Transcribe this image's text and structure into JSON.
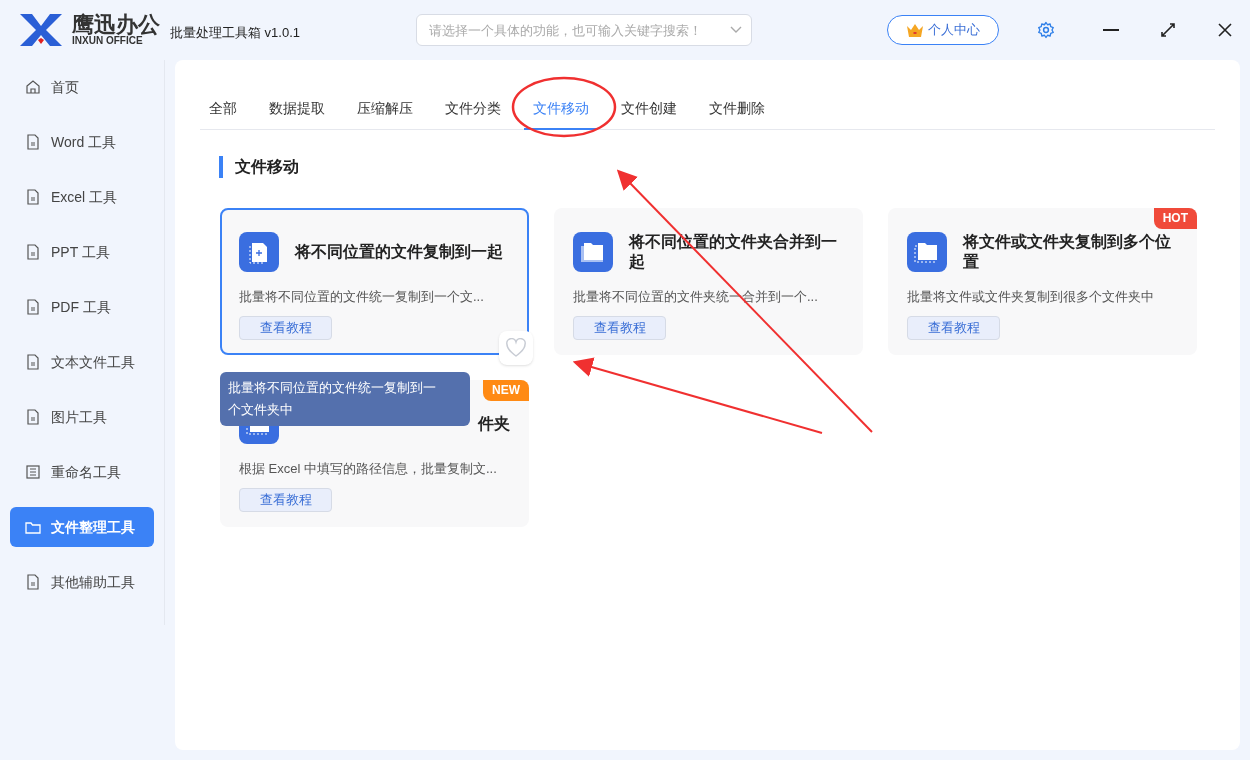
{
  "app": {
    "logo_cn": "鹰迅办公",
    "logo_en": "INXUN OFFICE",
    "title": "批量处理工具箱 v1.0.1"
  },
  "search": {
    "placeholder": "请选择一个具体的功能，也可输入关键字搜索！"
  },
  "user_button": "个人中心",
  "sidebar": {
    "items": [
      {
        "label": "首页",
        "kind": "home",
        "selected": false
      },
      {
        "label": "Word 工具",
        "kind": "doc",
        "selected": false
      },
      {
        "label": "Excel 工具",
        "kind": "doc",
        "selected": false
      },
      {
        "label": "PPT 工具",
        "kind": "doc",
        "selected": false
      },
      {
        "label": "PDF 工具",
        "kind": "doc",
        "selected": false
      },
      {
        "label": "文本文件工具",
        "kind": "doc",
        "selected": false
      },
      {
        "label": "图片工具",
        "kind": "doc",
        "selected": false
      },
      {
        "label": "重命名工具",
        "kind": "list",
        "selected": false
      },
      {
        "label": "文件整理工具",
        "kind": "folder",
        "selected": true
      },
      {
        "label": "其他辅助工具",
        "kind": "doc",
        "selected": false
      }
    ]
  },
  "tabs": [
    {
      "label": "全部",
      "selected": false
    },
    {
      "label": "数据提取",
      "selected": false
    },
    {
      "label": "压缩解压",
      "selected": false
    },
    {
      "label": "文件分类",
      "selected": false
    },
    {
      "label": "文件移动",
      "selected": true
    },
    {
      "label": "文件创建",
      "selected": false
    },
    {
      "label": "文件删除",
      "selected": false
    }
  ],
  "section_title": "文件移动",
  "cards": [
    {
      "title": "将不同位置的文件复制到一起",
      "description": "批量将不同位置的文件统一复制到一个文...",
      "button": "查看教程",
      "kind": "file",
      "selected": true
    },
    {
      "title": "将不同位置的文件夹合并到一起",
      "description": "批量将不同位置的文件夹统一合并到一个...",
      "button": "查看教程",
      "kind": "folders",
      "selected": false
    },
    {
      "title": "将文件或文件夹复制到多个位置",
      "description": "批量将文件或文件夹复制到很多个文件夹中",
      "button": "查看教程",
      "kind": "folder",
      "selected": false,
      "badge": "HOT",
      "color": "#f04a3a"
    },
    {
      "title": "件夹",
      "description": "根据 Excel 中填写的路径信息，批量复制文...",
      "button": "查看教程",
      "kind": "folder",
      "selected": false,
      "badge": "NEW",
      "color": "#ff8a14"
    }
  ],
  "tooltip": "批量将不同位置的文件统一复制到一个文件夹中"
}
